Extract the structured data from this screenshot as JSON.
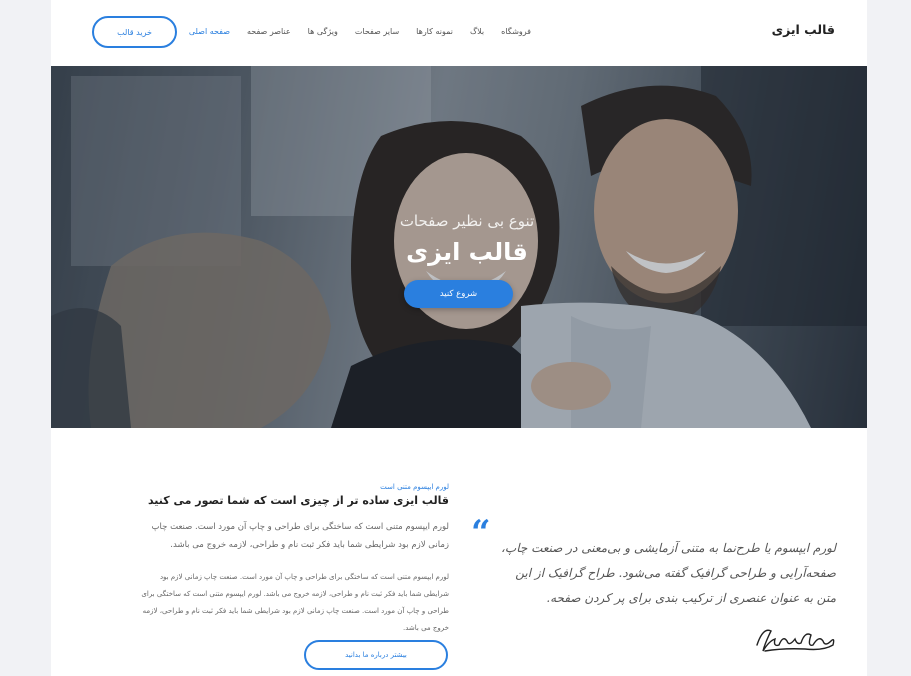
{
  "header": {
    "brand": "قالب ایزی",
    "nav": [
      {
        "label": "صفحه اصلی",
        "active": true
      },
      {
        "label": "عناصر صفحه",
        "active": false
      },
      {
        "label": "ویژگی ها",
        "active": false
      },
      {
        "label": "سایر صفحات",
        "active": false
      },
      {
        "label": "نمونه کارها",
        "active": false
      },
      {
        "label": "بلاگ",
        "active": false
      },
      {
        "label": "فروشگاه",
        "active": false
      }
    ],
    "buy_button": "خرید قالب"
  },
  "hero": {
    "subtitle": "تنوع بی نظیر صفحات",
    "title": "قالب ایزی",
    "cta": "شروع کنید"
  },
  "about": {
    "tag": "لورم ایپسوم متنی است",
    "title": "قالب ایزی ساده تر از چیزی است که شما  تصور می کنید",
    "lead": "لورم ایپسوم متنی است که ساختگی برای طراحی و چاپ آن مورد است. صنعت چاپ زمانی لازم بود شرایطی شما باید فکر ثبت نام و طراحی، لازمه خروج می باشد.",
    "body": "لورم ایپسوم متنی است که ساختگی برای طراحی و چاپ آن مورد است. صنعت چاپ زمانی لازم بود شرایطی شما باید فکر ثبت نام و طراحی، لازمه خروج می باشد. لورم ایپسوم متنی است که ساختگی برای طراحی و چاپ آن مورد است. صنعت چاپ زمانی لازم بود شرایطی شما باید فکر ثبت نام و طراحی، لازمه خروج می باشد.",
    "more_button": "بیشتر درباره ما بدانید"
  },
  "testimonial": {
    "quote": "لورم ایپسوم یا طرح‌نما به متنی آزمایشی و بی‌معنی در صنعت چاپ، صفحه‌آرایی و طراحی گرافیک گفته می‌شود. طراح گرافیک از این متن به عنوان عنصری از ترکیب بندی برای پر کردن صفحه.",
    "signature": "JohnDoe"
  },
  "colors": {
    "accent": "#2a7fdf",
    "text": "#222222",
    "muted": "#666666"
  }
}
